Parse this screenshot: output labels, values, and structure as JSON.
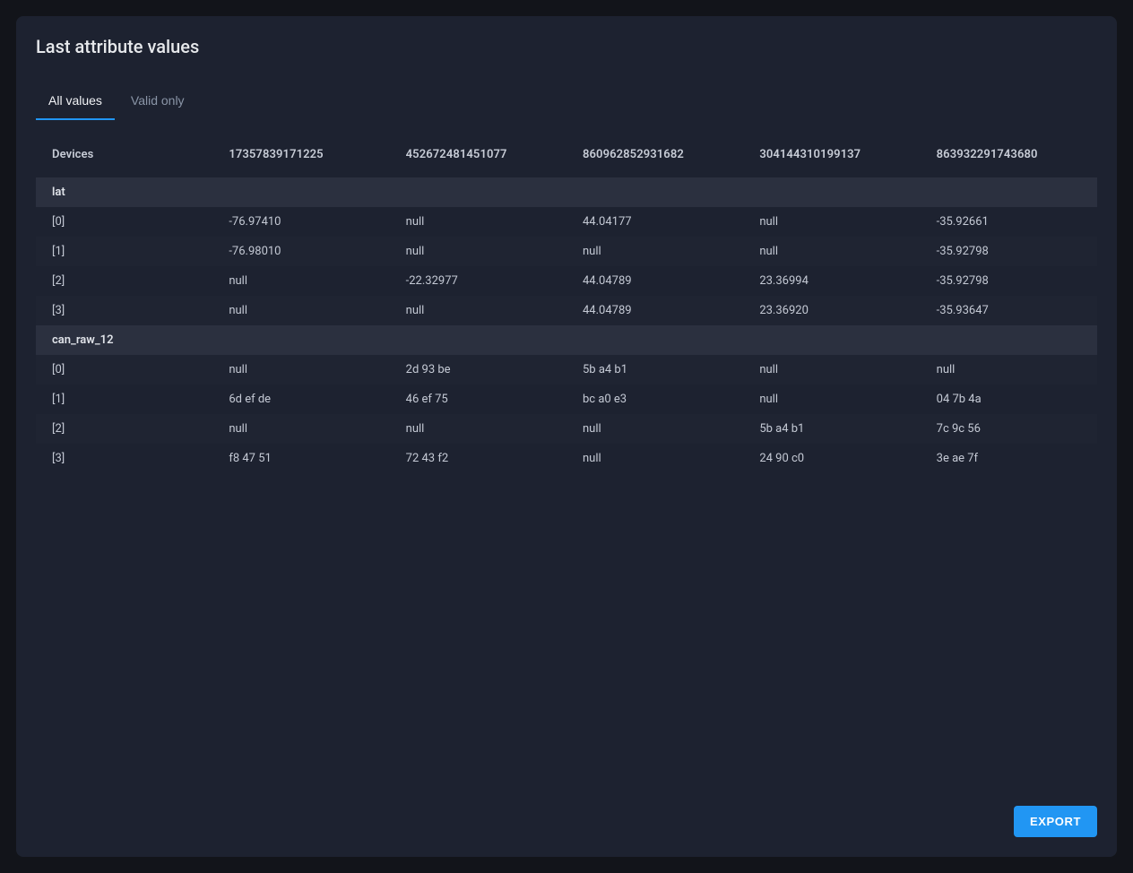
{
  "title": "Last attribute values",
  "tabs": [
    {
      "label": "All values",
      "active": true
    },
    {
      "label": "Valid only",
      "active": false
    }
  ],
  "columns": [
    "Devices",
    "17357839171225",
    "452672481451077",
    "860962852931682",
    "304144310199137",
    "863932291743680"
  ],
  "groups": [
    {
      "name": "lat",
      "rows": [
        {
          "idx": "[0]",
          "c1": "-76.97410",
          "c2": "null",
          "c3": "44.04177",
          "c4": "null",
          "c5": "-35.92661"
        },
        {
          "idx": "[1]",
          "c1": "-76.98010",
          "c2": "null",
          "c3": "null",
          "c4": "null",
          "c5": "-35.92798"
        },
        {
          "idx": "[2]",
          "c1": "null",
          "c2": "-22.32977",
          "c3": "44.04789",
          "c4": "23.36994",
          "c5": "-35.92798"
        },
        {
          "idx": "[3]",
          "c1": "null",
          "c2": "null",
          "c3": "44.04789",
          "c4": "23.36920",
          "c5": "-35.93647"
        }
      ]
    },
    {
      "name": "can_raw_12",
      "rows": [
        {
          "idx": "[0]",
          "c1": "null",
          "c2": "2d 93 be",
          "c3": "5b a4 b1",
          "c4": "null",
          "c5": "null"
        },
        {
          "idx": "[1]",
          "c1": "6d ef de",
          "c2": "46 ef 75",
          "c3": "bc a0 e3",
          "c4": "null",
          "c5": "04 7b 4a"
        },
        {
          "idx": "[2]",
          "c1": "null",
          "c2": "null",
          "c3": "null",
          "c4": "5b a4 b1",
          "c5": "7c 9c 56"
        },
        {
          "idx": "[3]",
          "c1": "f8 47 51",
          "c2": "72 43 f2",
          "c3": "null",
          "c4": "24 90 c0",
          "c5": "3e ae 7f"
        }
      ]
    }
  ],
  "export_label": "EXPORT"
}
